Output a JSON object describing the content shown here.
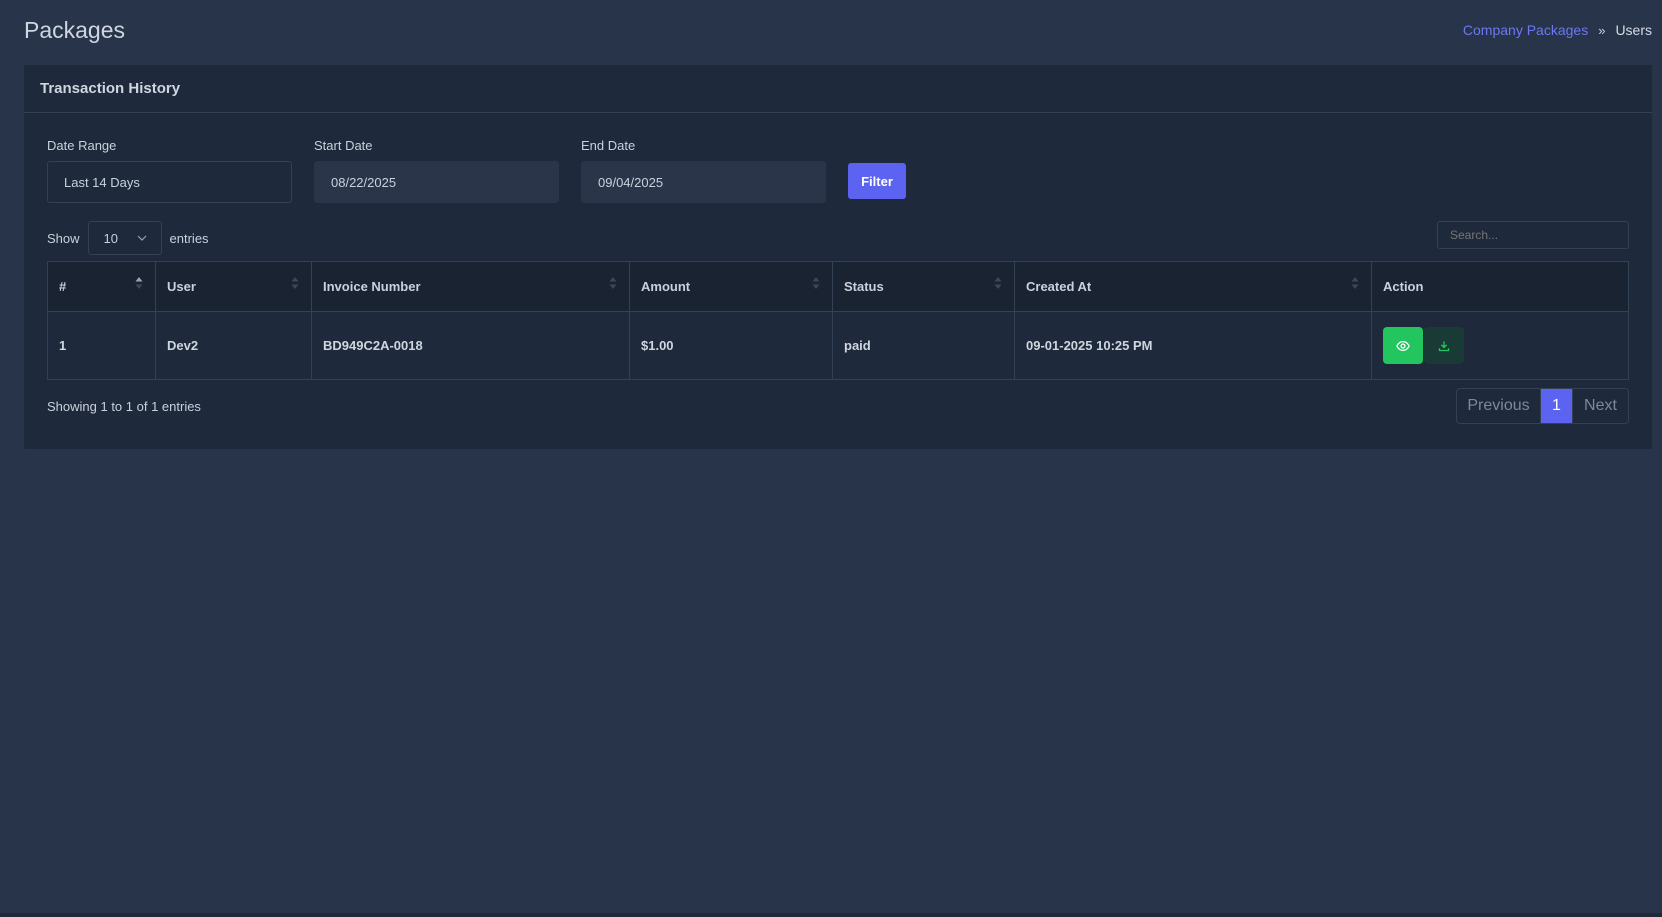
{
  "header": {
    "title": "Packages",
    "breadcrumb": {
      "link": "Company Packages",
      "separator": "»",
      "current": "Users"
    }
  },
  "card": {
    "title": "Transaction History"
  },
  "filters": {
    "date_range": {
      "label": "Date Range",
      "value": "Last 14 Days"
    },
    "start_date": {
      "label": "Start Date",
      "value": "08/22/2025"
    },
    "end_date": {
      "label": "End Date",
      "value": "09/04/2025"
    },
    "filter_button": "Filter"
  },
  "length": {
    "show": "Show",
    "value": "10",
    "entries": "entries"
  },
  "search": {
    "placeholder": "Search..."
  },
  "table": {
    "columns": [
      "#",
      "User",
      "Invoice Number",
      "Amount",
      "Status",
      "Created At",
      "Action"
    ],
    "rows": [
      {
        "num": "1",
        "user": "Dev2",
        "invoice": "BD949C2A-0018",
        "amount": "$1.00",
        "status": "paid",
        "created": "09-01-2025 10:25 PM"
      }
    ]
  },
  "footer": {
    "info": "Showing 1 to 1 of 1 entries",
    "pagination": {
      "previous": "Previous",
      "current": "1",
      "next": "Next"
    }
  },
  "colors": {
    "background": "#28344a",
    "card": "#1e293b",
    "accent": "#5b63f0",
    "success": "#22c55e",
    "link": "#6b78f0"
  },
  "icons": {
    "view": "eye-icon",
    "download": "download-icon",
    "select": "chevron-down-icon",
    "sort": "sort-icon"
  }
}
